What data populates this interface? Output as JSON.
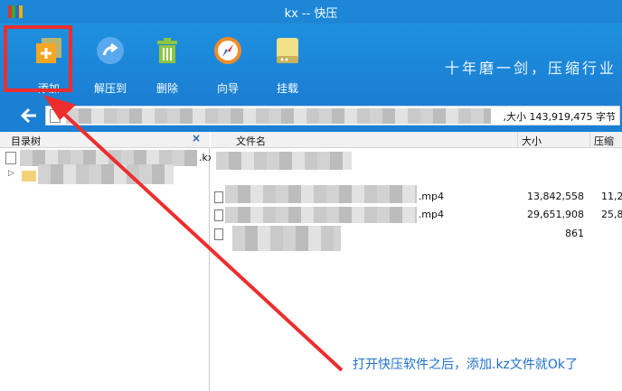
{
  "titlebar": {
    "title": "kx -- 快压"
  },
  "toolbar": {
    "items": [
      {
        "label": "添加",
        "icon": "add-icon"
      },
      {
        "label": "解压到",
        "icon": "extract-icon"
      },
      {
        "label": "删除",
        "icon": "trash-icon"
      },
      {
        "label": "向导",
        "icon": "compass-icon"
      },
      {
        "label": "挂载",
        "icon": "drive-icon"
      }
    ],
    "slogan": "十年磨一剑，压缩行业  "
  },
  "addressbar": {
    "path_suffix": ",大小 143,919,475 字节"
  },
  "tree": {
    "title": "目录树",
    "close_glyph": "×",
    "row1_suffix": ".kx"
  },
  "list": {
    "columns": [
      "文件名",
      "大小",
      "压缩"
    ],
    "rows": [
      {
        "ext": ".mp4",
        "size": "13,842,558",
        "compressed": "11,2"
      },
      {
        "ext": ".mp4",
        "size": "29,651,908",
        "compressed": "25,8"
      },
      {
        "ext": "",
        "size": "861",
        "compressed": ""
      }
    ]
  },
  "caption": "打开快压软件之后，添加.kz文件就Ok了",
  "colors": {
    "toolbar_blue": "#1b7fd3",
    "highlight_red": "#ee2d2d",
    "caption_blue": "#2070d0"
  }
}
